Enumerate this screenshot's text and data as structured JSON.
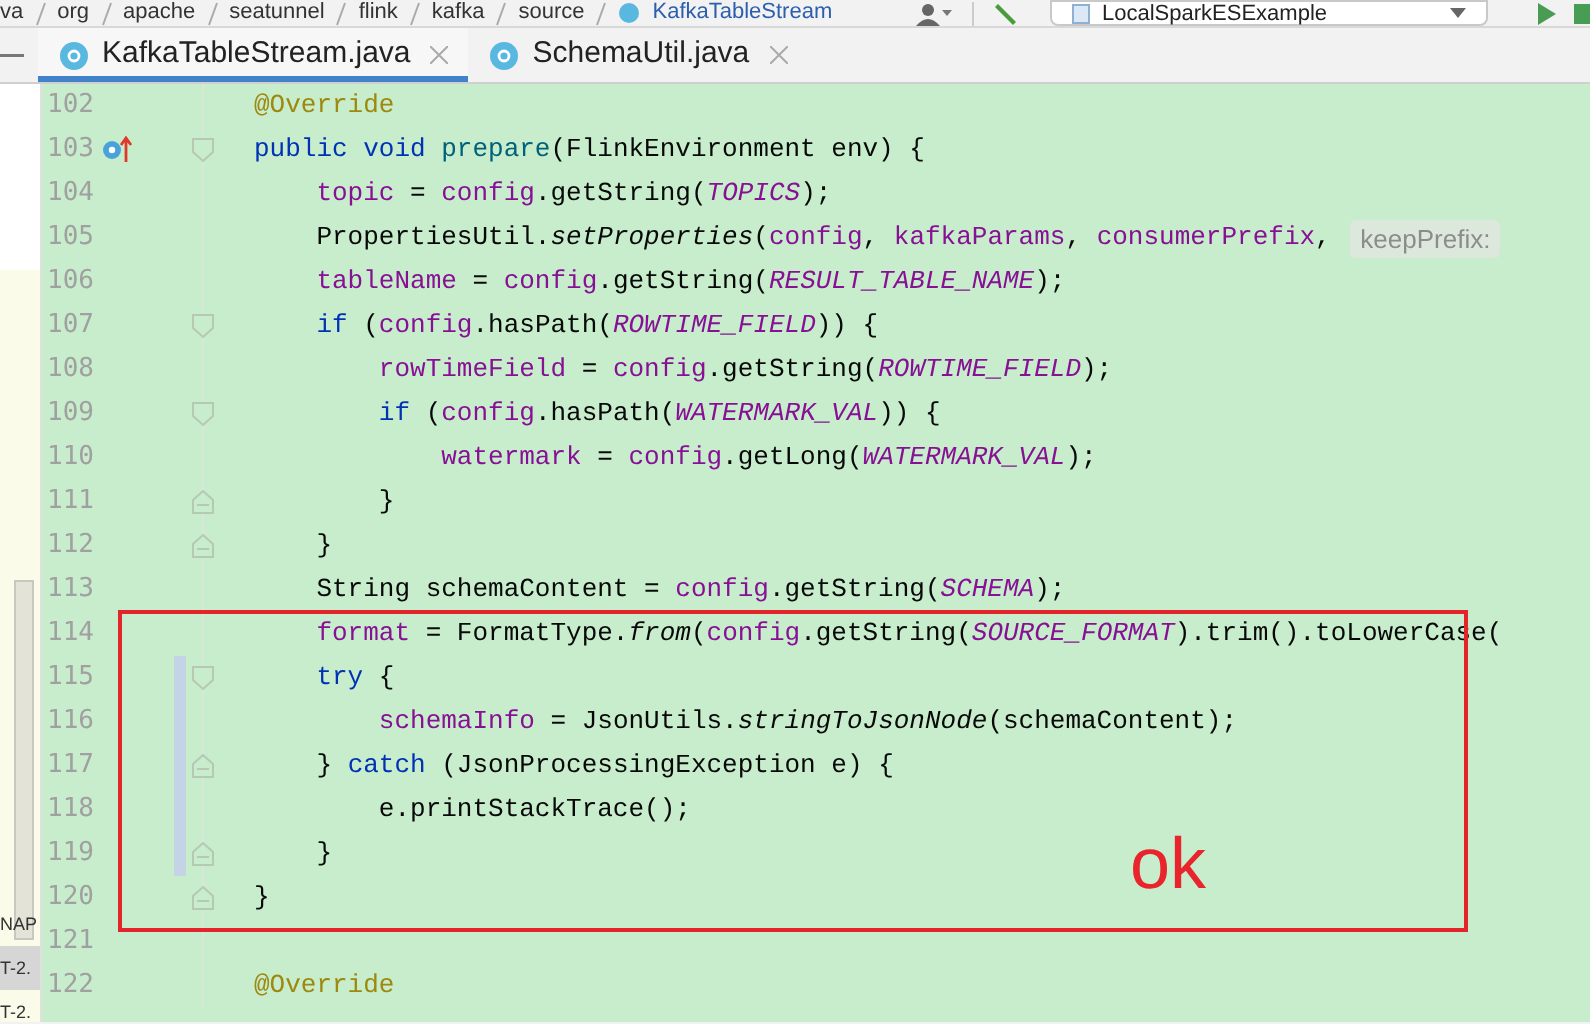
{
  "breadcrumb": [
    "va",
    "org",
    "apache",
    "seatunnel",
    "flink",
    "kafka",
    "source",
    "KafkaTableStream"
  ],
  "toolbar": {
    "run_config": "LocalSparkESExample"
  },
  "tabs": [
    {
      "label": "KafkaTableStream.java",
      "selected": true
    },
    {
      "label": "SchemaUtil.java",
      "selected": false
    }
  ],
  "side_panel": {
    "items": [
      {
        "text": "NAP",
        "selected": false
      },
      {
        "text": "T-2.",
        "selected": true
      },
      {
        "text": "T-2.",
        "selected": false
      }
    ]
  },
  "editor": {
    "lines": [
      {
        "number": "102",
        "override": false,
        "fold_start": false,
        "fold_end": false,
        "changed": false,
        "tokens": [
          {
            "kind": "ann",
            "text": "@Override"
          }
        ]
      },
      {
        "number": "103",
        "override": true,
        "fold_start": true,
        "fold_end": false,
        "changed": false,
        "tokens": [
          {
            "kind": "kw",
            "text": "public void "
          },
          {
            "kind": "mth",
            "text": "prepare"
          },
          {
            "kind": "txt",
            "text": "(FlinkEnvironment env) {"
          }
        ]
      },
      {
        "number": "104",
        "override": false,
        "fold_start": false,
        "fold_end": false,
        "changed": false,
        "tokens": [
          {
            "kind": "fld",
            "text": "    topic"
          },
          {
            "kind": "txt",
            "text": " = "
          },
          {
            "kind": "fld",
            "text": "config"
          },
          {
            "kind": "txt",
            "text": ".getString("
          },
          {
            "kind": "const",
            "text": "TOPICS"
          },
          {
            "kind": "txt",
            "text": ");"
          }
        ]
      },
      {
        "number": "105",
        "override": false,
        "fold_start": false,
        "fold_end": false,
        "changed": false,
        "tokens": [
          {
            "kind": "txt",
            "text": "    PropertiesUtil."
          },
          {
            "kind": "ital",
            "text": "setProperties"
          },
          {
            "kind": "txt",
            "text": "("
          },
          {
            "kind": "fld",
            "text": "config"
          },
          {
            "kind": "txt",
            "text": ", "
          },
          {
            "kind": "fld",
            "text": "kafkaParams"
          },
          {
            "kind": "txt",
            "text": ", "
          },
          {
            "kind": "fld",
            "text": "consumerPrefix"
          },
          {
            "kind": "txt",
            "text": ", "
          },
          {
            "kind": "hint",
            "text": "keepPrefix:"
          }
        ]
      },
      {
        "number": "106",
        "override": false,
        "fold_start": false,
        "fold_end": false,
        "changed": false,
        "tokens": [
          {
            "kind": "fld",
            "text": "    tableName"
          },
          {
            "kind": "txt",
            "text": " = "
          },
          {
            "kind": "fld",
            "text": "config"
          },
          {
            "kind": "txt",
            "text": ".getString("
          },
          {
            "kind": "const",
            "text": "RESULT_TABLE_NAME"
          },
          {
            "kind": "txt",
            "text": ");"
          }
        ]
      },
      {
        "number": "107",
        "override": false,
        "fold_start": true,
        "fold_end": false,
        "changed": false,
        "tokens": [
          {
            "kind": "kw",
            "text": "    if"
          },
          {
            "kind": "txt",
            "text": " ("
          },
          {
            "kind": "fld",
            "text": "config"
          },
          {
            "kind": "txt",
            "text": ".hasPath("
          },
          {
            "kind": "const",
            "text": "ROWTIME_FIELD"
          },
          {
            "kind": "txt",
            "text": ")) {"
          }
        ]
      },
      {
        "number": "108",
        "override": false,
        "fold_start": false,
        "fold_end": false,
        "changed": false,
        "tokens": [
          {
            "kind": "fld",
            "text": "        rowTimeField"
          },
          {
            "kind": "txt",
            "text": " = "
          },
          {
            "kind": "fld",
            "text": "config"
          },
          {
            "kind": "txt",
            "text": ".getString("
          },
          {
            "kind": "const",
            "text": "ROWTIME_FIELD"
          },
          {
            "kind": "txt",
            "text": ");"
          }
        ]
      },
      {
        "number": "109",
        "override": false,
        "fold_start": true,
        "fold_end": false,
        "changed": false,
        "tokens": [
          {
            "kind": "kw",
            "text": "        if"
          },
          {
            "kind": "txt",
            "text": " ("
          },
          {
            "kind": "fld",
            "text": "config"
          },
          {
            "kind": "txt",
            "text": ".hasPath("
          },
          {
            "kind": "const",
            "text": "WATERMARK_VAL"
          },
          {
            "kind": "txt",
            "text": ")) {"
          }
        ]
      },
      {
        "number": "110",
        "override": false,
        "fold_start": false,
        "fold_end": false,
        "changed": false,
        "tokens": [
          {
            "kind": "fld",
            "text": "            watermark"
          },
          {
            "kind": "txt",
            "text": " = "
          },
          {
            "kind": "fld",
            "text": "config"
          },
          {
            "kind": "txt",
            "text": ".getLong("
          },
          {
            "kind": "const",
            "text": "WATERMARK_VAL"
          },
          {
            "kind": "txt",
            "text": ");"
          }
        ]
      },
      {
        "number": "111",
        "override": false,
        "fold_start": false,
        "fold_end": true,
        "changed": false,
        "tokens": [
          {
            "kind": "txt",
            "text": "        }"
          }
        ]
      },
      {
        "number": "112",
        "override": false,
        "fold_start": false,
        "fold_end": true,
        "changed": false,
        "tokens": [
          {
            "kind": "txt",
            "text": "    }"
          }
        ]
      },
      {
        "number": "113",
        "override": false,
        "fold_start": false,
        "fold_end": false,
        "changed": false,
        "tokens": [
          {
            "kind": "txt",
            "text": "    String schemaContent = "
          },
          {
            "kind": "fld",
            "text": "config"
          },
          {
            "kind": "txt",
            "text": ".getString("
          },
          {
            "kind": "const",
            "text": "SCHEMA"
          },
          {
            "kind": "txt",
            "text": ");"
          }
        ]
      },
      {
        "number": "114",
        "override": false,
        "fold_start": false,
        "fold_end": false,
        "changed": false,
        "tokens": [
          {
            "kind": "fld",
            "text": "    format"
          },
          {
            "kind": "txt",
            "text": " = FormatType."
          },
          {
            "kind": "ital",
            "text": "from"
          },
          {
            "kind": "txt",
            "text": "("
          },
          {
            "kind": "fld",
            "text": "config"
          },
          {
            "kind": "txt",
            "text": ".getString("
          },
          {
            "kind": "const",
            "text": "SOURCE_FORMAT"
          },
          {
            "kind": "txt",
            "text": ").trim().toLowerCase("
          }
        ]
      },
      {
        "number": "115",
        "override": false,
        "fold_start": true,
        "fold_end": false,
        "changed": true,
        "tokens": [
          {
            "kind": "kw",
            "text": "    try"
          },
          {
            "kind": "txt",
            "text": " {"
          }
        ]
      },
      {
        "number": "116",
        "override": false,
        "fold_start": false,
        "fold_end": false,
        "changed": true,
        "tokens": [
          {
            "kind": "fld",
            "text": "        schemaInfo"
          },
          {
            "kind": "txt",
            "text": " = JsonUtils."
          },
          {
            "kind": "ital",
            "text": "stringToJsonNode"
          },
          {
            "kind": "txt",
            "text": "(schemaContent);"
          }
        ]
      },
      {
        "number": "117",
        "override": false,
        "fold_start": false,
        "fold_end": true,
        "changed": true,
        "tokens": [
          {
            "kind": "txt",
            "text": "    } "
          },
          {
            "kind": "kw",
            "text": "catch"
          },
          {
            "kind": "txt",
            "text": " (JsonProcessingException e) {"
          }
        ]
      },
      {
        "number": "118",
        "override": false,
        "fold_start": false,
        "fold_end": false,
        "changed": true,
        "tokens": [
          {
            "kind": "txt",
            "text": "        e.printStackTrace();"
          }
        ]
      },
      {
        "number": "119",
        "override": false,
        "fold_start": false,
        "fold_end": true,
        "changed": true,
        "tokens": [
          {
            "kind": "txt",
            "text": "    }"
          }
        ]
      },
      {
        "number": "120",
        "override": false,
        "fold_start": false,
        "fold_end": true,
        "changed": false,
        "tokens": [
          {
            "kind": "txt",
            "text": "}"
          }
        ]
      },
      {
        "number": "121",
        "override": false,
        "fold_start": false,
        "fold_end": false,
        "changed": false
      },
      {
        "number": "122",
        "override": false,
        "fold_start": false,
        "fold_end": false,
        "changed": false,
        "tokens": [
          {
            "kind": "ann",
            "text": "@Override"
          }
        ]
      }
    ]
  },
  "annotation": {
    "text": "ok"
  }
}
